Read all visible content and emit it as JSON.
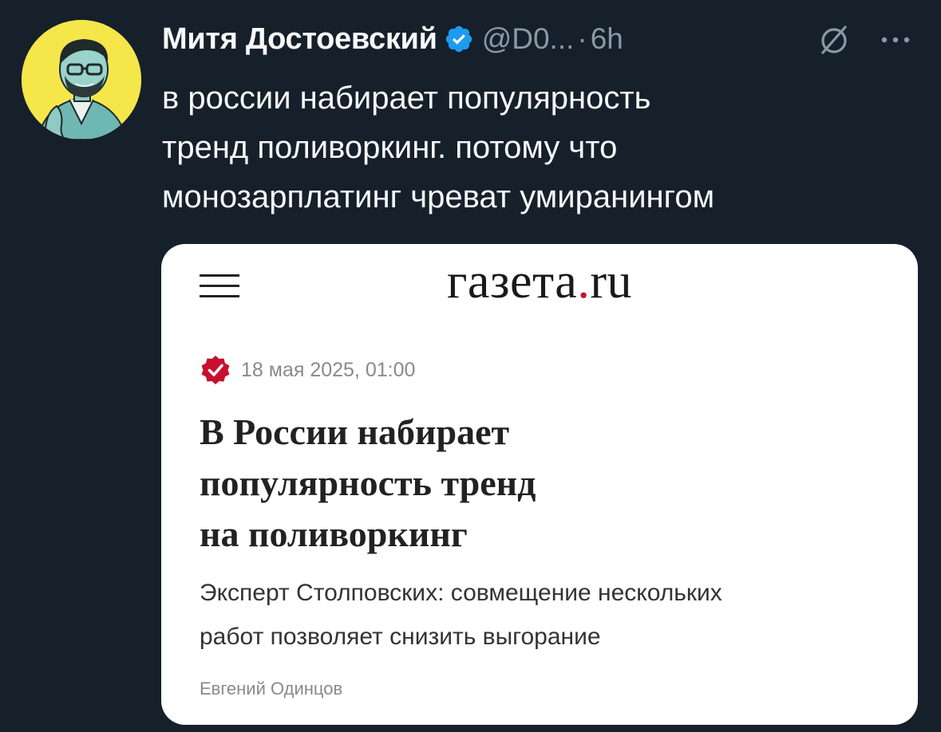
{
  "tweet": {
    "author_name": "Митя Достоевский",
    "handle": "@D0...",
    "separator": "·",
    "time": "6h",
    "text_lines": [
      "в россии набирает популярность",
      "тренд поливоркинг. потому что",
      "монозарплатинг чреват умиранингом"
    ],
    "icons": {
      "avatar": "avatar",
      "verified": "verified-badge-icon",
      "grok": "grok-icon",
      "more": "more-icon"
    },
    "colors": {
      "background": "#15202b",
      "verified": "#1d9bf0",
      "secondary_text": "#8b98a5",
      "avatar_bg": "#f5e64a"
    }
  },
  "media": {
    "site_logo": {
      "main": "газета",
      "dot": ".",
      "tld": "ru"
    },
    "date": "18 мая 2025, 01:00",
    "title_lines": [
      "В России набирает",
      "популярность тренд",
      "на поливоркинг"
    ],
    "lead_lines": [
      "Эксперт Столповских: совмещение нескольких",
      "работ позволяет снизить выгорание"
    ],
    "author": "Евгений Одинцов",
    "colors": {
      "accent": "#c8102e"
    }
  }
}
